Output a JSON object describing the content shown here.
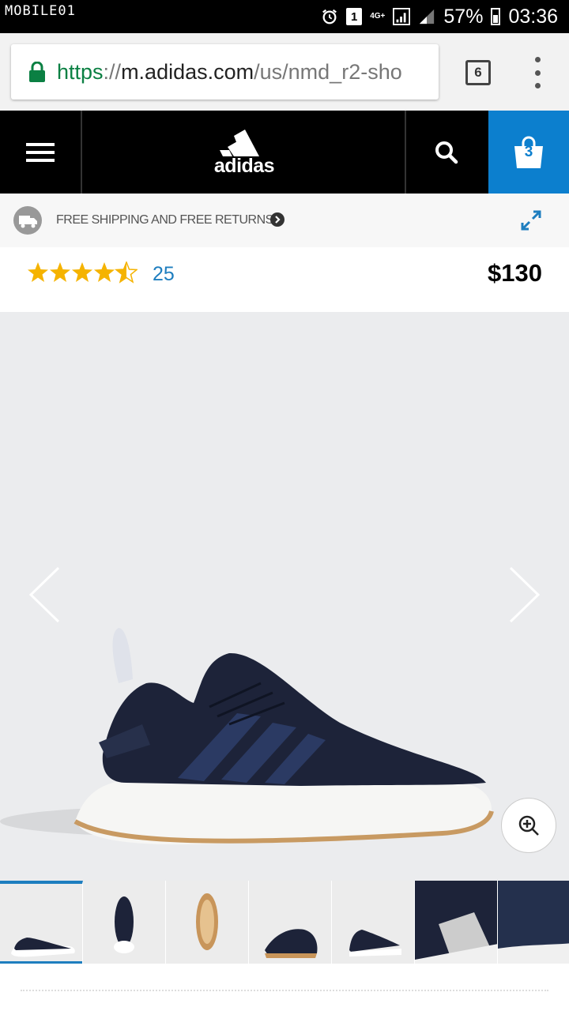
{
  "status_bar": {
    "carrier_logo": "MOBILE01",
    "sim_slot": "1",
    "network": "4G+",
    "battery": "57%",
    "time": "03:36"
  },
  "browser": {
    "url_scheme": "https",
    "url_sep": "://",
    "url_host": "m.adidas.com",
    "url_path": "/us/nmd_r2-sho",
    "tab_count": "6"
  },
  "site_header": {
    "brand": "adidas",
    "cart_count": "3"
  },
  "shipping": {
    "label": "FREE SHIPPING AND FREE RETURNS"
  },
  "product": {
    "rating": 4.5,
    "rating_max": 5,
    "review_count": "25",
    "price": "$130"
  },
  "gallery": {
    "thumbnail_count": 7,
    "active_thumbnail": 1
  },
  "colors": {
    "accent_blue": "#1e7ebf",
    "cart_blue": "#0c7fce",
    "star_gold": "#f5b300",
    "lock_green": "#0b8043"
  }
}
